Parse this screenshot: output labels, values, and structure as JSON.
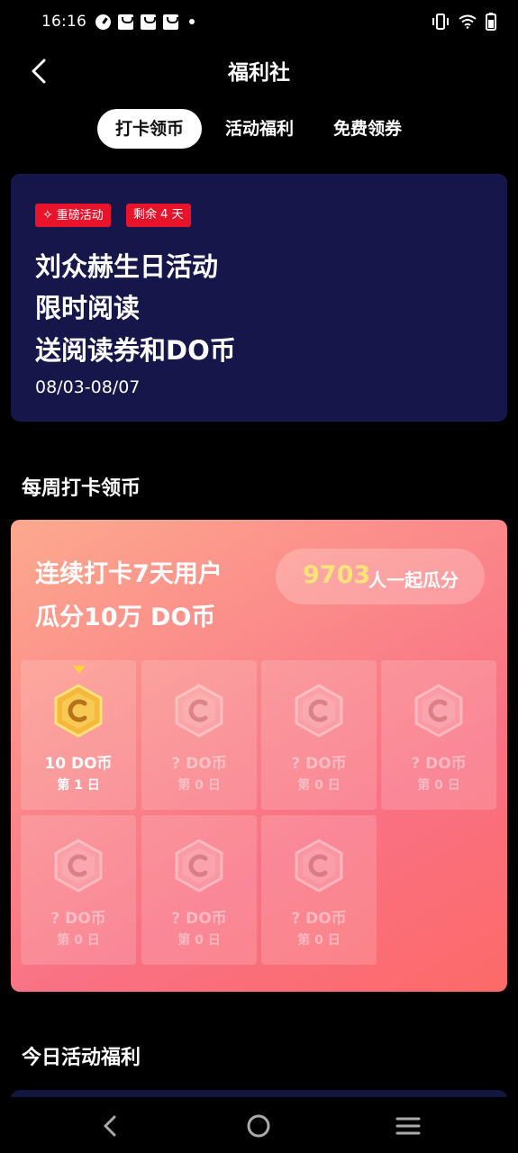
{
  "status_bar": {
    "time": "16:16"
  },
  "header": {
    "title": "福利社"
  },
  "tabs": [
    {
      "label": "打卡领币",
      "active": true
    },
    {
      "label": "活动福利",
      "active": false
    },
    {
      "label": "免费领券",
      "active": false
    }
  ],
  "banner": {
    "badges": [
      "重磅活动",
      "剩余 4 天"
    ],
    "lines": [
      "刘众赫生日活动",
      "限时阅读",
      "送阅读券和DO币"
    ],
    "dates": "08/03-08/07"
  },
  "weekly_section": {
    "title": "每周打卡领币"
  },
  "weekly_card": {
    "lines": [
      "连续打卡7天用户",
      "瓜分10万 DO币"
    ],
    "participants": "9703",
    "participants_suffix": "人一起瓜分",
    "days": [
      {
        "value": "10 DO币",
        "label": "第 1 日",
        "done": true
      },
      {
        "value": "? DO币",
        "label": "第 0 日",
        "done": false
      },
      {
        "value": "? DO币",
        "label": "第 0 日",
        "done": false
      },
      {
        "value": "? DO币",
        "label": "第 0 日",
        "done": false
      },
      {
        "value": "? DO币",
        "label": "第 0 日",
        "done": false
      },
      {
        "value": "? DO币",
        "label": "第 0 日",
        "done": false
      },
      {
        "value": "? DO币",
        "label": "第 0 日",
        "done": false
      }
    ]
  },
  "today_section": {
    "title": "今日活动福利"
  },
  "colors": {
    "banner_bg": "#16164a",
    "badge_red": "#e8142c",
    "coin_gold": "#f5b83a",
    "highlight_yellow": "#ffe27a"
  }
}
